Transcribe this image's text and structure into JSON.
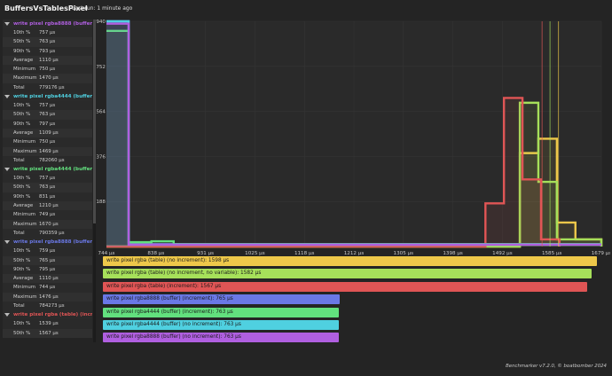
{
  "header": {
    "title": "BuffersVsTablesPixel",
    "last_run": "Last run: 1 minute ago"
  },
  "sidebar": {
    "groups": [
      {
        "title": "write pixel rgba8888 (buffer) (no...",
        "color": "#b05fe0",
        "stats": [
          [
            "10th %",
            "757 µs"
          ],
          [
            "50th %",
            "763 µs"
          ],
          [
            "90th %",
            "793 µs"
          ],
          [
            "Average",
            "1110 µs"
          ],
          [
            "Minimum",
            "750 µs"
          ],
          [
            "Maximum",
            "1470 µs"
          ],
          [
            "Total",
            "779176 µs"
          ]
        ]
      },
      {
        "title": "write pixel rgba4444 (buffer) (no...",
        "color": "#4fd0e0",
        "stats": [
          [
            "10th %",
            "757 µs"
          ],
          [
            "50th %",
            "763 µs"
          ],
          [
            "90th %",
            "797 µs"
          ],
          [
            "Average",
            "1109 µs"
          ],
          [
            "Minimum",
            "750 µs"
          ],
          [
            "Maximum",
            "1469 µs"
          ],
          [
            "Total",
            "782060 µs"
          ]
        ]
      },
      {
        "title": "write pixel rgba4444 (buffer) (inc...",
        "color": "#62e07e",
        "stats": [
          [
            "10th %",
            "757 µs"
          ],
          [
            "50th %",
            "763 µs"
          ],
          [
            "90th %",
            "831 µs"
          ],
          [
            "Average",
            "1210 µs"
          ],
          [
            "Minimum",
            "749 µs"
          ],
          [
            "Maximum",
            "1670 µs"
          ],
          [
            "Total",
            "790359 µs"
          ]
        ]
      },
      {
        "title": "write pixel rgba8888 (buffer) (inc...",
        "color": "#6a78e6",
        "stats": [
          [
            "10th %",
            "759 µs"
          ],
          [
            "50th %",
            "765 µs"
          ],
          [
            "90th %",
            "795 µs"
          ],
          [
            "Average",
            "1110 µs"
          ],
          [
            "Minimum",
            "744 µs"
          ],
          [
            "Maximum",
            "1476 µs"
          ],
          [
            "Total",
            "784273 µs"
          ]
        ]
      },
      {
        "title": "write pixel rgba (table) (increme...",
        "color": "#e05555",
        "stats": [
          [
            "10th %",
            "1539 µs"
          ],
          [
            "50th %",
            "1567 µs"
          ]
        ]
      }
    ]
  },
  "chart_data": {
    "type": "histogram",
    "x_ticks": [
      "744 µs",
      "838 µs",
      "931 µs",
      "1025 µs",
      "1118 µs",
      "1212 µs",
      "1305 µs",
      "1398 µs",
      "1492 µs",
      "1585 µs",
      "1679 µs"
    ],
    "x_range": [
      744,
      1679
    ],
    "y_ticks": [
      "940",
      "752",
      "564",
      "376",
      "188"
    ],
    "y_range": [
      0,
      940
    ],
    "series": [
      {
        "name": "write pixel rgba (table) (no increment)",
        "color": "#eec84a",
        "points": [
          [
            744,
            0
          ],
          [
            1492,
            0
          ],
          [
            1525,
            0
          ],
          [
            1525,
            390
          ],
          [
            1560,
            390
          ],
          [
            1560,
            450
          ],
          [
            1595,
            450
          ],
          [
            1595,
            100
          ],
          [
            1630,
            100
          ],
          [
            1630,
            30
          ],
          [
            1679,
            30
          ],
          [
            1679,
            0
          ]
        ]
      },
      {
        "name": "write pixel rgba (table) (no increment, no variable)",
        "color": "#a6e05a",
        "points": [
          [
            744,
            0
          ],
          [
            1492,
            0
          ],
          [
            1525,
            0
          ],
          [
            1525,
            600
          ],
          [
            1560,
            600
          ],
          [
            1560,
            270
          ],
          [
            1595,
            270
          ],
          [
            1595,
            30
          ],
          [
            1679,
            30
          ],
          [
            1679,
            0
          ]
        ]
      },
      {
        "name": "write pixel rgba (table) (increment)",
        "color": "#e05555",
        "points": [
          [
            744,
            0
          ],
          [
            1460,
            0
          ],
          [
            1460,
            180
          ],
          [
            1495,
            180
          ],
          [
            1495,
            620
          ],
          [
            1530,
            620
          ],
          [
            1530,
            280
          ],
          [
            1565,
            280
          ],
          [
            1565,
            30
          ],
          [
            1600,
            30
          ],
          [
            1600,
            0
          ]
        ]
      },
      {
        "name": "write pixel rgba8888 (buffer) (increment)",
        "color": "#6a78e6",
        "points": [
          [
            744,
            940
          ],
          [
            786,
            940
          ],
          [
            786,
            10
          ],
          [
            1679,
            10
          ]
        ]
      },
      {
        "name": "write pixel rgba4444 (buffer) (increment)",
        "color": "#62e07e",
        "points": [
          [
            744,
            900
          ],
          [
            786,
            900
          ],
          [
            786,
            18
          ],
          [
            829,
            18
          ],
          [
            829,
            22
          ],
          [
            871,
            22
          ],
          [
            871,
            10
          ],
          [
            1679,
            10
          ]
        ]
      },
      {
        "name": "write pixel rgba4444 (buffer) (no increment)",
        "color": "#4fd0e0",
        "points": [
          [
            744,
            940
          ],
          [
            786,
            940
          ],
          [
            786,
            8
          ],
          [
            1679,
            8
          ]
        ]
      },
      {
        "name": "write pixel rgba8888 (buffer) (no increment)",
        "color": "#b05fe0",
        "points": [
          [
            744,
            930
          ],
          [
            786,
            930
          ],
          [
            786,
            8
          ],
          [
            1679,
            8
          ]
        ]
      }
    ],
    "markers": [
      {
        "value": 1567,
        "color": "#e05555"
      },
      {
        "value": 1582,
        "color": "#a6e05a"
      },
      {
        "value": 1598,
        "color": "#eec84a"
      }
    ]
  },
  "legend_bars": [
    {
      "label": "write pixel rgba (table) (no increment): 1598 µs",
      "value": 1598,
      "color": "#eec84a"
    },
    {
      "label": "write pixel rgba (table) (no increment, no variable): 1582 µs",
      "value": 1582,
      "color": "#a6e05a"
    },
    {
      "label": "write pixel rgba (table) (increment): 1567 µs",
      "value": 1567,
      "color": "#e05555"
    },
    {
      "label": "write pixel rgba8888 (buffer) (increment): 765 µs",
      "value": 765,
      "color": "#6a78e6"
    },
    {
      "label": "write pixel rgba4444 (buffer) (increment): 763 µs",
      "value": 763,
      "color": "#62e07e"
    },
    {
      "label": "write pixel rgba4444 (buffer) (no increment): 763 µs",
      "value": 763,
      "color": "#4fd0e0"
    },
    {
      "label": "write pixel rgba8888 (buffer) (no increment): 763 µs",
      "value": 763,
      "color": "#b05fe0"
    }
  ],
  "footer": {
    "credit": "Benchmarker v7.2.0, © boatbomber 2024"
  }
}
